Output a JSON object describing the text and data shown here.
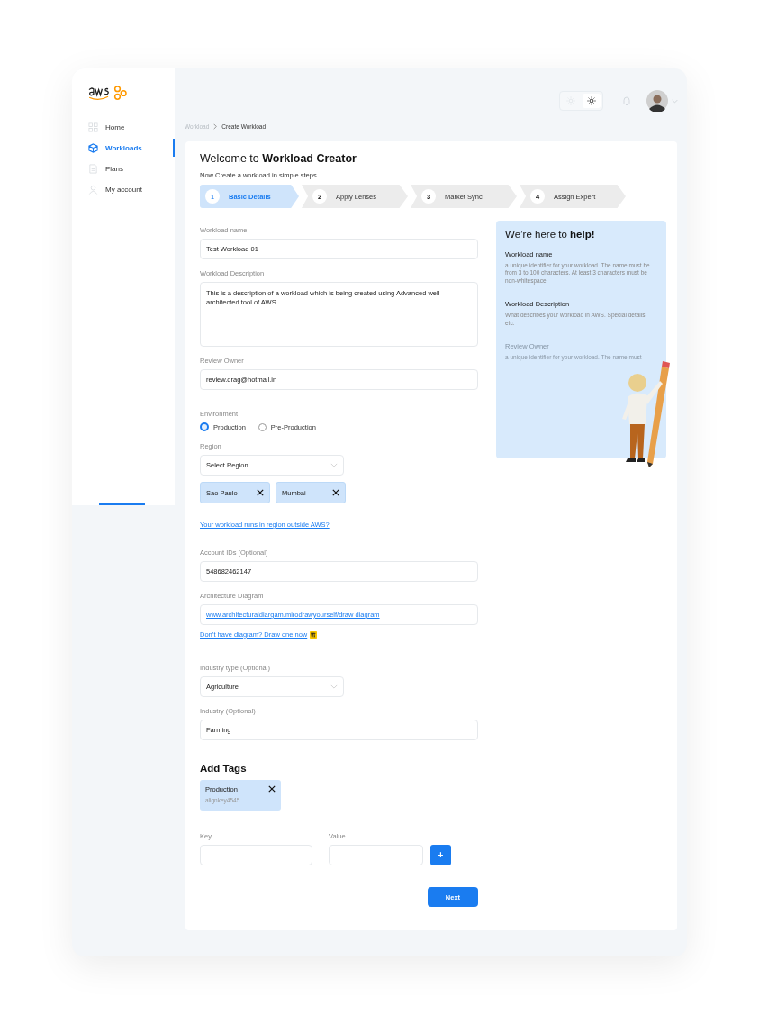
{
  "sidebar": {
    "items": [
      {
        "label": "Home",
        "selected": false
      },
      {
        "label": "Workloads",
        "selected": true
      },
      {
        "label": "Plans",
        "selected": false
      },
      {
        "label": "My account",
        "selected": false
      }
    ]
  },
  "theme_toggle": {
    "options": [
      {
        "selected": false
      },
      {
        "selected": true
      }
    ]
  },
  "breadcrumb": [
    "Workload",
    "Create Workload"
  ],
  "header": {
    "title": "Welcome to **Workload Creator**",
    "subtitle": "Now Create a workload in simple steps"
  },
  "steps": [
    {
      "number": "1",
      "label": "Basic Details",
      "selected": true
    },
    {
      "number": "2",
      "label": "Apply Lenses",
      "selected": false
    },
    {
      "number": "3",
      "label": "Market Sync",
      "selected": false
    },
    {
      "number": "4",
      "label": "Assign Expert",
      "selected": false
    }
  ],
  "form": {
    "workload_name": {
      "label": "Workload name",
      "value": "Test Workload 01"
    },
    "workload_description": {
      "label": "Workload Description",
      "value": "This is a description of a workload which is being created using Advanced well-architected tool of AWS"
    },
    "review_owner": {
      "label": "Review Owner",
      "value": "review.drag@hotmail.in"
    },
    "environment": {
      "label": "Environment",
      "options": [
        {
          "label": "Production",
          "selected": true
        },
        {
          "label": "Pre-Production",
          "selected": false
        }
      ]
    },
    "region": {
      "label": "Region",
      "placeholder": "Select Region",
      "chips": [
        "Sao Paulo",
        "Mumbai"
      ]
    },
    "outside_link": "Your workload runs in region outside AWS?",
    "account_ids": {
      "label": "Account IDs (Optional)",
      "value": "548682462147"
    },
    "architecture_diagram": {
      "label": "Architecture Diagram",
      "value": "www.architecturaldiargam.mirodrawyourself/draw diagram"
    },
    "draw_link": "Don’t have diagram? Draw one now",
    "industry_type": {
      "label": "Industry type (Optional)",
      "value": "Agriculture"
    },
    "industry": {
      "label": "Industry (Optional)",
      "value": "Farming"
    }
  },
  "tags": {
    "title": "Add Tags",
    "items": [
      {
        "key": "Production",
        "value": "alignkey4545"
      }
    ],
    "key_label": "Key",
    "value_label": "Value",
    "add_button": "+"
  },
  "next_button": "Next",
  "help": {
    "title": "We’re here to **help!**",
    "items": [
      {
        "title": "Workload name",
        "text": "a unique identifier for your workload. The name must be from 3 to 100 characters. At least 3 characters must be non-whitespace",
        "faded": false
      },
      {
        "title": "Workload Description",
        "text": "What describes your workload in AWS. Special details, etc.",
        "faded": false
      },
      {
        "title": "Review Owner",
        "text": "a unique identifier for your workload. The name must",
        "faded": true
      }
    ]
  }
}
